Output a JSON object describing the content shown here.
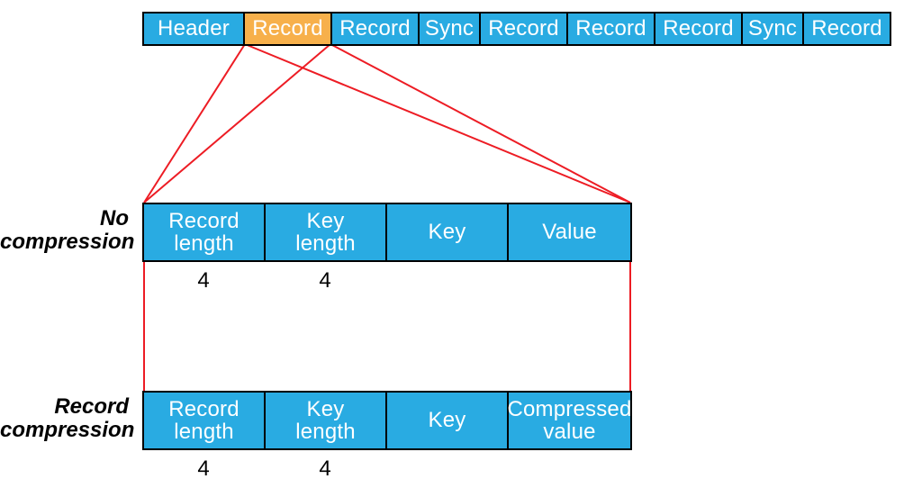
{
  "top_row": {
    "cells": [
      {
        "label": "Header",
        "highlight": false
      },
      {
        "label": "Record",
        "highlight": true
      },
      {
        "label": "Record",
        "highlight": false
      },
      {
        "label": "Sync",
        "highlight": false
      },
      {
        "label": "Record",
        "highlight": false
      },
      {
        "label": "Record",
        "highlight": false
      },
      {
        "label": "Record",
        "highlight": false
      },
      {
        "label": "Sync",
        "highlight": false
      },
      {
        "label": "Record",
        "highlight": false
      }
    ]
  },
  "no_compression": {
    "title": "No\ncompression",
    "cells": [
      {
        "label": "Record\nlength",
        "bytes": "4"
      },
      {
        "label": "Key\nlength",
        "bytes": "4"
      },
      {
        "label": "Key",
        "bytes": ""
      },
      {
        "label": "Value",
        "bytes": ""
      }
    ]
  },
  "record_compression": {
    "title": "Record\ncompression",
    "cells": [
      {
        "label": "Record\nlength",
        "bytes": "4"
      },
      {
        "label": "Key\nlength",
        "bytes": "4"
      },
      {
        "label": "Key",
        "bytes": ""
      },
      {
        "label": "Compressed\nvalue",
        "bytes": ""
      }
    ]
  }
}
